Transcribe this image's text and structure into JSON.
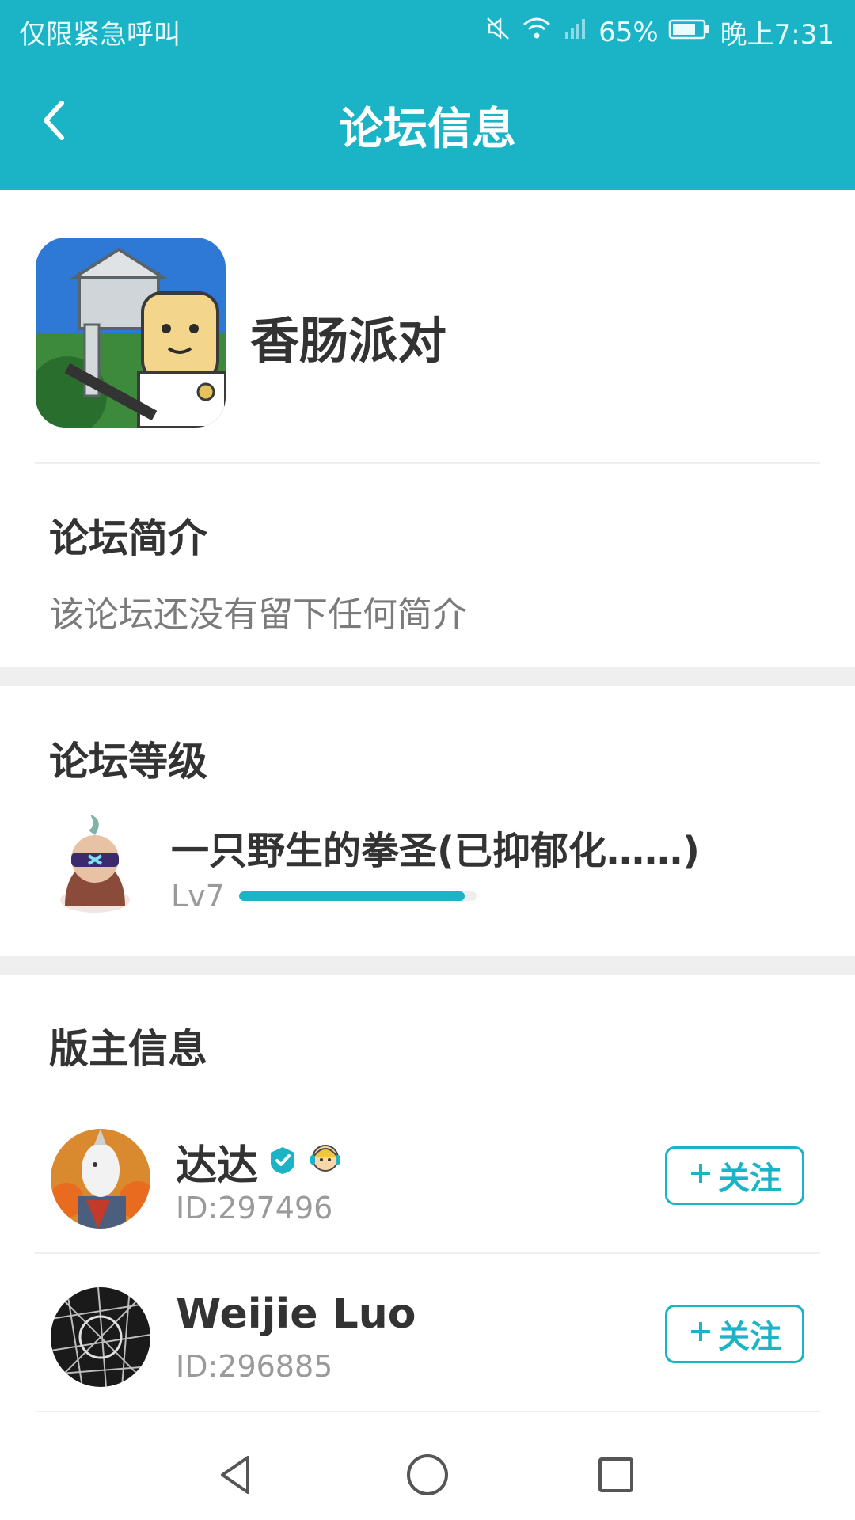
{
  "status_bar": {
    "carrier_text": "仅限紧急呼叫",
    "battery": "65%",
    "time": "晚上7:31"
  },
  "header": {
    "title": "论坛信息",
    "back_icon": "chevron-left-icon",
    "color": "#1bb3c6"
  },
  "forum": {
    "name": "香肠派对",
    "icon": "game-logo"
  },
  "intro": {
    "title": "论坛简介",
    "text": "该论坛还没有留下任何简介"
  },
  "level": {
    "title": "论坛等级",
    "user_name": "一只野生的拳圣(已抑郁化……)",
    "level_label": "Lv7",
    "progress": 0.95
  },
  "moderators": {
    "title": "版主信息",
    "follow_label": "关注",
    "items": [
      {
        "name": "达达",
        "id": "ID:297496",
        "verified": true
      },
      {
        "name": "Weijie  Luo",
        "id": "ID:296885",
        "verified": false
      }
    ]
  },
  "navbar": {
    "back": "triangle-back-icon",
    "home": "circle-home-icon",
    "recent": "square-recent-icon"
  }
}
